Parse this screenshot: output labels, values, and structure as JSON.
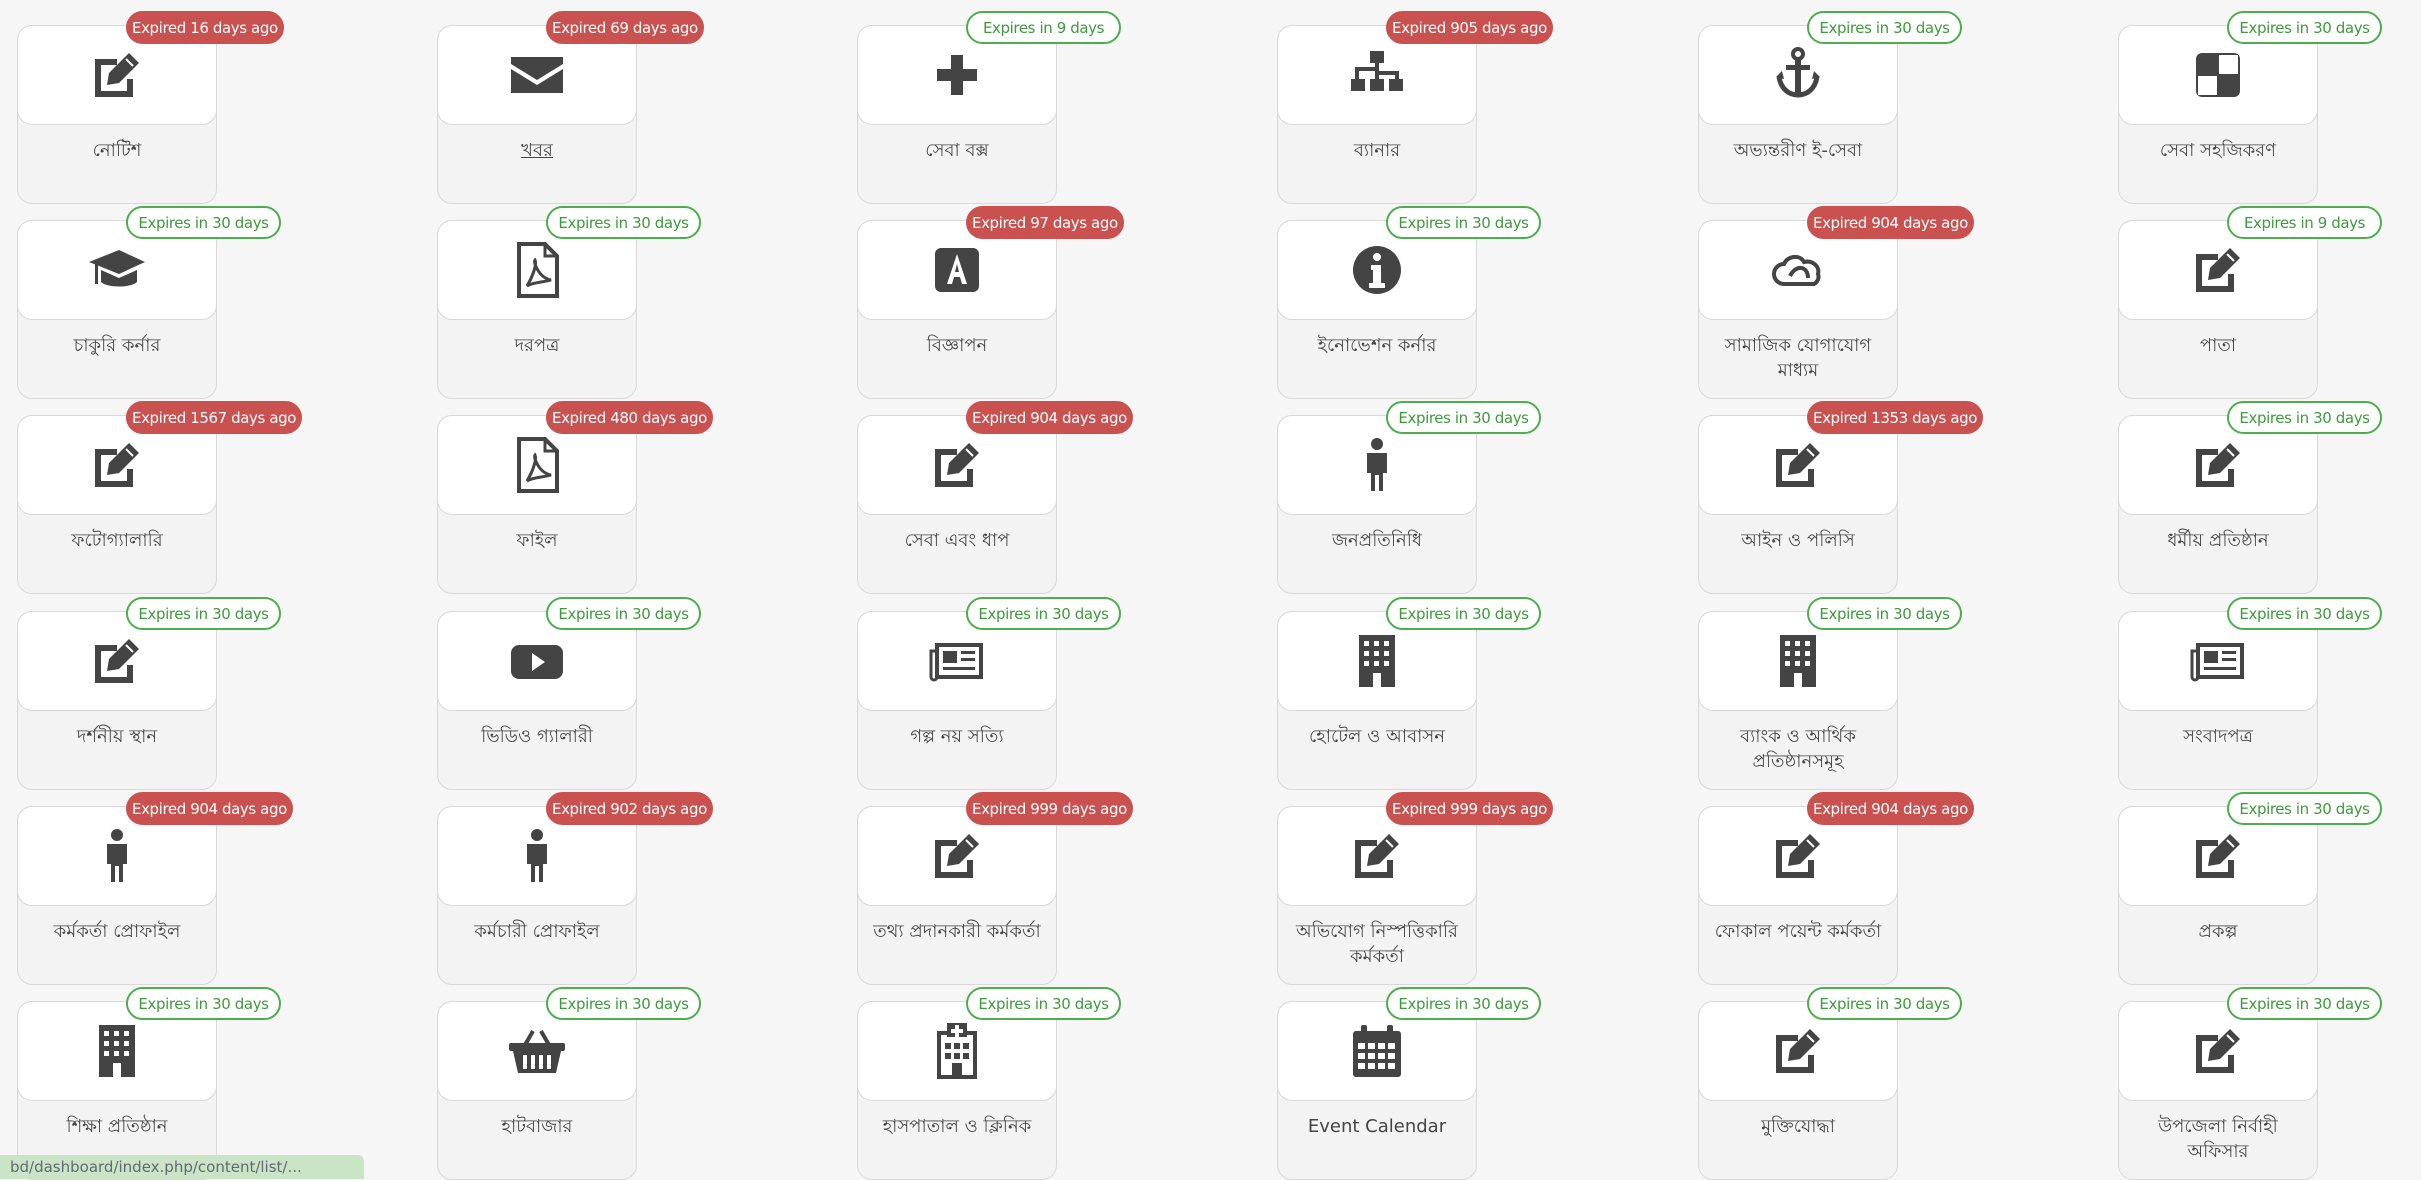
{
  "items": [
    {
      "label": "নোটিশ",
      "badge": "Expired 16 days ago",
      "status": "expired",
      "icon": "edit-icon"
    },
    {
      "label": "খবর",
      "badge": "Expired 69 days ago",
      "status": "expired",
      "icon": "envelope-icon",
      "link": true
    },
    {
      "label": "সেবা বক্স",
      "badge": "Expires in 9 days",
      "status": "expires",
      "icon": "plus-icon"
    },
    {
      "label": "ব্যানার",
      "badge": "Expired 905 days ago",
      "status": "expired",
      "icon": "sitemap-icon"
    },
    {
      "label": "অভ্যন্তরীণ ই-সেবা",
      "badge": "Expires in 30 days",
      "status": "expires",
      "icon": "anchor-icon"
    },
    {
      "label": "সেবা সহজিকরণ",
      "badge": "Expires in 30 days",
      "status": "expires",
      "icon": "quadrant-icon"
    },
    {
      "label": "চাকুরি কর্নার",
      "badge": "Expires in 30 days",
      "status": "expires",
      "icon": "graduation-cap-icon"
    },
    {
      "label": "দরপত্র",
      "badge": "Expires in 30 days",
      "status": "expires",
      "icon": "pdf-file-icon"
    },
    {
      "label": "বিজ্ঞাপন",
      "badge": "Expired 97 days ago",
      "status": "expired",
      "icon": "letter-a-icon"
    },
    {
      "label": "ইনোভেশন কর্নার",
      "badge": "Expires in 30 days",
      "status": "expires",
      "icon": "info-icon"
    },
    {
      "label": "সামাজিক যোগাযোগ মাধ্যম",
      "badge": "Expired 904 days ago",
      "status": "expired",
      "icon": "cloud-link-icon"
    },
    {
      "label": "পাতা",
      "badge": "Expires in 9 days",
      "status": "expires",
      "icon": "edit-icon"
    },
    {
      "label": "ফটোগ্যালারি",
      "badge": "Expired 1567 days ago",
      "status": "expired",
      "icon": "edit-icon"
    },
    {
      "label": "ফাইল",
      "badge": "Expired 480 days ago",
      "status": "expired",
      "icon": "pdf-file-icon"
    },
    {
      "label": "সেবা এবং ধাপ",
      "badge": "Expired 904 days ago",
      "status": "expired",
      "icon": "edit-icon"
    },
    {
      "label": "জনপ্রতিনিধি",
      "badge": "Expires in 30 days",
      "status": "expires",
      "icon": "person-icon"
    },
    {
      "label": "আইন ও পলিসি",
      "badge": "Expired 1353 days ago",
      "status": "expired",
      "icon": "edit-icon"
    },
    {
      "label": "ধর্মীয় প্রতিষ্ঠান",
      "badge": "Expires in 30 days",
      "status": "expires",
      "icon": "edit-icon"
    },
    {
      "label": "দর্শনীয় স্থান",
      "badge": "Expires in 30 days",
      "status": "expires",
      "icon": "edit-icon"
    },
    {
      "label": "ভিডিও গ্যালারী",
      "badge": "Expires in 30 days",
      "status": "expires",
      "icon": "youtube-play-icon"
    },
    {
      "label": "গল্প নয় সত্যি",
      "badge": "Expires in 30 days",
      "status": "expires",
      "icon": "newspaper-icon"
    },
    {
      "label": "হোটেল ও আবাসন",
      "badge": "Expires in 30 days",
      "status": "expires",
      "icon": "building-icon"
    },
    {
      "label": "ব্যাংক ও আর্থিক প্রতিষ্ঠানসমূহ",
      "badge": "Expires in 30 days",
      "status": "expires",
      "icon": "building-icon"
    },
    {
      "label": "সংবাদপত্র",
      "badge": "Expires in 30 days",
      "status": "expires",
      "icon": "newspaper-icon"
    },
    {
      "label": "কর্মকর্তা প্রোফাইল",
      "badge": "Expired 904 days ago",
      "status": "expired",
      "icon": "person-icon"
    },
    {
      "label": "কর্মচারী প্রোফাইল",
      "badge": "Expired 902 days ago",
      "status": "expired",
      "icon": "person-icon"
    },
    {
      "label": "তথ্য প্রদানকারী কর্মকর্তা",
      "badge": "Expired 999 days ago",
      "status": "expired",
      "icon": "edit-icon"
    },
    {
      "label": "অভিযোগ নিস্পত্তিকারি কর্মকর্তা",
      "badge": "Expired 999 days ago",
      "status": "expired",
      "icon": "edit-icon"
    },
    {
      "label": "ফোকাল পয়েন্ট কর্মকর্তা",
      "badge": "Expired 904 days ago",
      "status": "expired",
      "icon": "edit-icon"
    },
    {
      "label": "প্রকল্প",
      "badge": "Expires in 30 days",
      "status": "expires",
      "icon": "edit-icon"
    },
    {
      "label": "শিক্ষা প্রতিষ্ঠান",
      "badge": "Expires in 30 days",
      "status": "expires",
      "icon": "building-icon"
    },
    {
      "label": "হাটবাজার",
      "badge": "Expires in 30 days",
      "status": "expires",
      "icon": "shopping-basket-icon"
    },
    {
      "label": "হাসপাতাল ও ক্লিনিক",
      "badge": "Expires in 30 days",
      "status": "expires",
      "icon": "hospital-icon"
    },
    {
      "label": "Event Calendar",
      "badge": "Expires in 30 days",
      "status": "expires",
      "icon": "calendar-icon"
    },
    {
      "label": "মুক্তিযোদ্ধা",
      "badge": "Expires in 30 days",
      "status": "expires",
      "icon": "edit-icon"
    },
    {
      "label": "উপজেলা নির্বাহী অফিসার",
      "badge": "Expires in 30 days",
      "status": "expires",
      "icon": "edit-icon"
    }
  ],
  "status_bar": {
    "url": "bd/dashboard/index.php/content/list/..."
  }
}
